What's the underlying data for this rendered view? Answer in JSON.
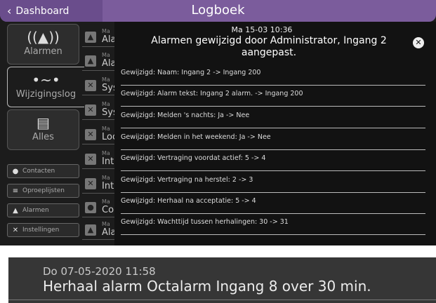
{
  "header": {
    "back_label": "Dashboard",
    "title": "Logboek"
  },
  "sidebar": {
    "tabs": [
      {
        "label": "Alarmen",
        "icon": "alarm-bell-icon"
      },
      {
        "label": "Wijzigingslog",
        "icon": "change-log-icon"
      },
      {
        "label": "Alles",
        "icon": "document-icon"
      }
    ],
    "buttons": [
      {
        "label": "Contacten",
        "icon": "person-icon"
      },
      {
        "label": "Oproeplijsten",
        "icon": "list-icon"
      },
      {
        "label": "Alarmen",
        "icon": "bell-icon"
      },
      {
        "label": "Instellingen",
        "icon": "tools-icon"
      }
    ]
  },
  "log_list": {
    "rows": [
      {
        "small": "Ma",
        "text": "Ala"
      },
      {
        "small": "Ma",
        "text": "Ala"
      },
      {
        "small": "Ma",
        "text": "Sys"
      },
      {
        "small": "Ma",
        "text": "Sys"
      },
      {
        "small": "Ma",
        "text": "Loc"
      },
      {
        "small": "Ma",
        "text": "Int"
      },
      {
        "small": "Ma",
        "text": "Int"
      },
      {
        "small": "Ma",
        "text": "Co"
      },
      {
        "small": "Ma",
        "text": "Ala"
      }
    ]
  },
  "modal": {
    "date": "Ma 15-03 10:36",
    "title_line1": "Alarmen gewijzigd door Administrator, Ingang 2",
    "title_line2": "aangepast.",
    "changes": [
      "Gewijzigd: Naam: Ingang 2 -> Ingang 200",
      "Gewijzigd: Alarm tekst: Ingang 2 alarm. -> Ingang 200",
      "Gewijzigd: Melden 's nachts: Ja -> Nee",
      "Gewijzigd: Melden in het weekend: Ja -> Nee",
      "Gewijzigd: Vertraging voordat actief: 5 -> 4",
      "Gewijzigd: Vertraging na herstel: 2 -> 3",
      "Gewijzigd: Herhaal na acceptatie: 5 -> 4",
      "Gewijzigd: Wachttijd tussen herhalingen: 30 -> 31"
    ]
  },
  "second_screen": {
    "date": "Do 07-05-2020 11:58",
    "message": "Herhaal alarm Octalarm Ingang 8 over 30 min."
  }
}
